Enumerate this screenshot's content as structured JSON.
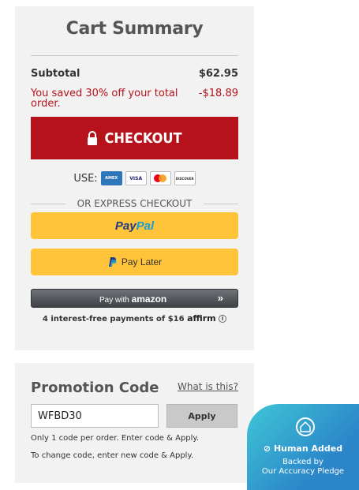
{
  "summary": {
    "title": "Cart Summary",
    "subtotal_label": "Subtotal",
    "subtotal_value": "$62.95",
    "saved_label": "You saved 30% off your total order.",
    "saved_value": "-$18.89",
    "checkout_label": "CHECKOUT",
    "use_label": "USE:",
    "cards": [
      "AMEX",
      "VISA",
      "MC",
      "DISCOVER"
    ],
    "express_label": "OR EXPRESS CHECKOUT",
    "paypal_part1": "Pay",
    "paypal_part2": "Pal",
    "paylater_label": "Pay Later",
    "amazon_prefix": "Pay with",
    "amazon_brand": "amazon",
    "amazon_arrow": "»",
    "affirm_text": "4 interest-free payments of $16",
    "affirm_logo": "affirm",
    "affirm_info": "i"
  },
  "promo": {
    "title": "Promotion Code",
    "help_link": "What is this?",
    "code_value": "WFBD30",
    "apply_label": "Apply",
    "note1": "Only 1 code per order. Enter code & Apply.",
    "note2": "To change code, enter new code & Apply."
  },
  "badge": {
    "line1": "Human Added",
    "line2": "Backed by",
    "line3": "Our Accuracy Pledge"
  },
  "colors": {
    "accent": "#b5121b",
    "paypal_yellow": "#ffc439",
    "badge_start": "#40c7d6",
    "badge_end": "#2b86c9"
  }
}
